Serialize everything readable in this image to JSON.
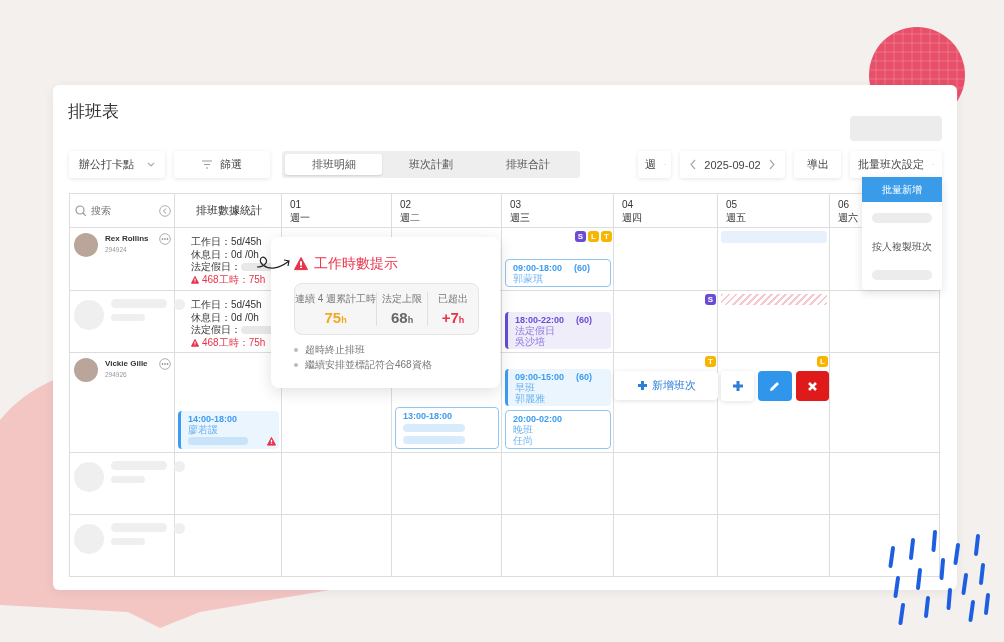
{
  "title": "排班表",
  "toolbar": {
    "location": "辦公打卡點",
    "filter": "篩選",
    "view": "週",
    "date": "2025-09-02",
    "export": "導出",
    "batch": "批量班次設定",
    "tabs": [
      {
        "label": "排班明細",
        "selected": true
      },
      {
        "label": "班次計劃",
        "selected": false
      },
      {
        "label": "排班合計",
        "selected": false
      }
    ]
  },
  "batch_menu": [
    {
      "kind": "item",
      "label": "批量新增",
      "selected": true
    },
    {
      "kind": "skeleton"
    },
    {
      "kind": "item",
      "label": "按人複製班次",
      "selected": false
    },
    {
      "kind": "skeleton"
    }
  ],
  "grid": {
    "search_placeholder": "搜索",
    "stats_heading": "排班數據統計",
    "days": [
      {
        "date": "01",
        "weekday": "週一"
      },
      {
        "date": "02",
        "weekday": "週二"
      },
      {
        "date": "03",
        "weekday": "週三"
      },
      {
        "date": "04",
        "weekday": "週四"
      },
      {
        "date": "05",
        "weekday": "週五"
      },
      {
        "date": "06",
        "weekday": "週六"
      }
    ],
    "rows": [
      {
        "kind": "employee",
        "name": "Rex Rollins",
        "id": "294924",
        "stats": {
          "work": "工作日：5d/45h",
          "rest": "休息日：0d /0h",
          "holiday": "法定假日：",
          "warning": "468工時：75h"
        },
        "cells": [
          {},
          {},
          {
            "badges": [
              {
                "letter": "S",
                "color": "#6a4bd3"
              },
              {
                "letter": "L",
                "color": "#f7b500"
              },
              {
                "letter": "T",
                "color": "#f7b500"
              }
            ],
            "items": [
              {
                "kind": "outlined_shift",
                "color": "#3d9cf0",
                "time": "09:00-18:00",
                "break": "(60)",
                "lines": [
                  {
                    "kind": "text",
                    "text": "郭蒙琪"
                  }
                ]
              }
            ]
          },
          {},
          {
            "items": [
              {
                "kind": "blank_bar"
              }
            ]
          },
          {}
        ]
      },
      {
        "kind": "skeleton",
        "stats": {
          "work": "工作日：5d/45h",
          "rest": "休息日：0d /0h",
          "holiday": "法定假日：",
          "warning": "468工時：75h"
        },
        "cells": [
          {},
          {},
          {
            "items": [
              {
                "kind": "filled_shift",
                "color": "#6a4bd3",
                "time": "18:00-22:00",
                "break": "(60)",
                "lines": [
                  {
                    "kind": "text",
                    "text": "法定假日"
                  },
                  {
                    "kind": "text",
                    "text": "吳沙培"
                  }
                ]
              }
            ]
          },
          {
            "badges": [
              {
                "letter": "S",
                "color": "#6a4bd3"
              }
            ]
          },
          {
            "items": [
              {
                "kind": "striped_bar"
              }
            ]
          },
          {}
        ]
      },
      {
        "kind": "employee",
        "name": "Vickie Gille",
        "id": "294926",
        "stats_cell": {
          "items": [
            {
              "kind": "filled_shift",
              "color": "#3d9cf0",
              "time": "14:00-18:00",
              "warning": true,
              "lines": [
                {
                  "kind": "text",
                  "text": "廖若諼"
                },
                {
                  "kind": "skeleton"
                }
              ]
            }
          ]
        },
        "cells": [
          {},
          {
            "items": [
              {
                "kind": "outlined_shift",
                "color": "#3d9cf0",
                "time": "13:00-18:00",
                "lines": [
                  {
                    "kind": "skeleton"
                  },
                  {
                    "kind": "skeleton"
                  }
                ]
              }
            ]
          },
          {
            "items": [
              {
                "kind": "filled_shift",
                "color": "#3d9cf0",
                "time": "09:00-15:00",
                "break": "(60)",
                "lines": [
                  {
                    "kind": "text",
                    "text": "早班"
                  },
                  {
                    "kind": "text",
                    "text": "郭麗雅"
                  }
                ]
              },
              {
                "kind": "outlined_shift",
                "color": "#3d9cf0",
                "time": "20:00-02:00",
                "lines": [
                  {
                    "kind": "text",
                    "text": "晚班"
                  },
                  {
                    "kind": "text",
                    "text": "任尚"
                  }
                ]
              }
            ]
          },
          {
            "badges": [
              {
                "letter": "T",
                "color": "#f7b500"
              }
            ],
            "items": [
              {
                "kind": "add_button",
                "label": "新增班次"
              }
            ]
          },
          {
            "badges": [
              {
                "letter": "L",
                "color": "#f7b500"
              }
            ],
            "items": [
              {
                "kind": "actions"
              }
            ]
          },
          {}
        ]
      },
      {
        "kind": "skeleton",
        "cells": [
          {},
          {},
          {},
          {},
          {},
          {}
        ]
      },
      {
        "kind": "skeleton",
        "cells": [
          {},
          {},
          {},
          {},
          {},
          {}
        ]
      }
    ]
  },
  "hours_tip": {
    "title": "工作時數提示",
    "metrics": [
      {
        "label": "連續 4 週累計工時",
        "value": "75",
        "unit": "h",
        "color": "#f5a623"
      },
      {
        "label": "法定上限",
        "value": "68",
        "unit": "h",
        "color": "#666666"
      },
      {
        "label": "已超出",
        "value": "+7",
        "unit": "h",
        "color": "#e8334a"
      }
    ],
    "bullets": [
      "超時終止排班",
      "繼續安排並標記符合468資格"
    ]
  }
}
